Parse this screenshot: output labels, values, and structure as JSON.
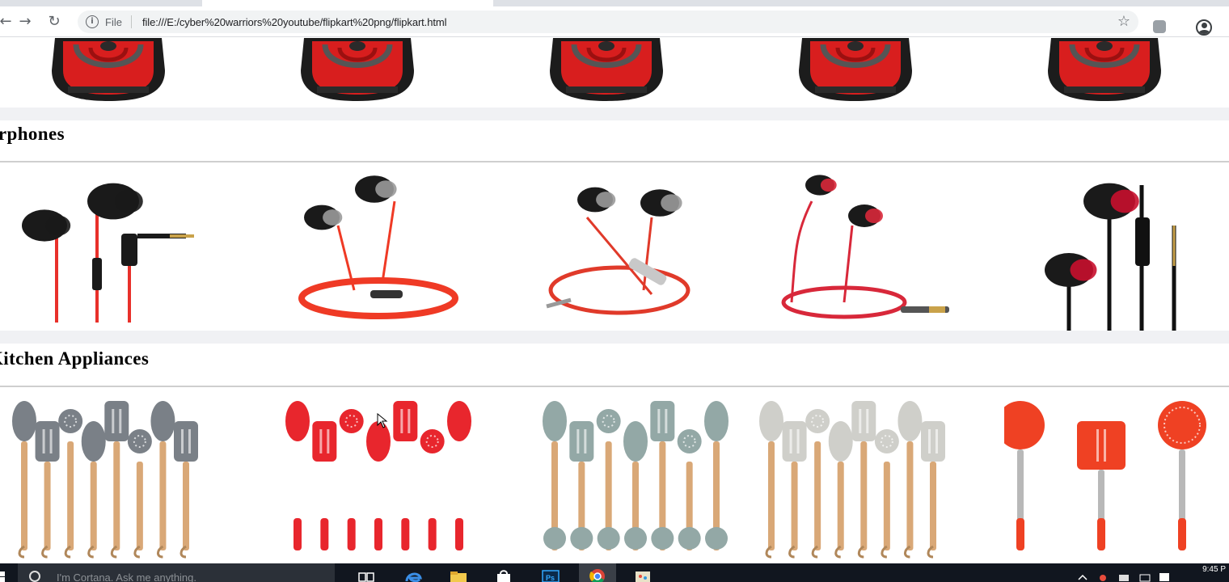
{
  "browser": {
    "scheme_label": "File",
    "url": "file:///E:/cyber%20warriors%20youtube/flipkart%20png/flipkart.html",
    "icons": [
      "back-icon",
      "forward-icon",
      "reload-icon",
      "info-icon",
      "star-icon",
      "extension-icon",
      "profile-icon"
    ]
  },
  "page": {
    "sections": [
      {
        "title": "",
        "product_type": "backpack",
        "item_colors": [
          "#d81e1e",
          "#d81e1e",
          "#d81e1e",
          "#d81e1e",
          "#d81e1e"
        ]
      },
      {
        "title": "arphones",
        "product_type": "earphones",
        "item_colors": [
          "#1a1a1a",
          "#ef3a25",
          "#e03a2a",
          "#d8283a",
          "#c8102e"
        ]
      },
      {
        "title": "Kitchen Appliances",
        "product_type": "utensils",
        "item_colors": [
          "#7a8087",
          "#e8262d",
          "#93a8a6",
          "#cfcfca",
          "#ef4123"
        ]
      }
    ]
  },
  "taskbar": {
    "search_placeholder": "I'm Cortana. Ask me anything.",
    "clock": "9:45 P",
    "pinned": [
      "task-view-icon",
      "edge-icon",
      "file-explorer-icon",
      "store-icon",
      "photoshop-icon",
      "chrome-icon",
      "paint-icon"
    ]
  }
}
